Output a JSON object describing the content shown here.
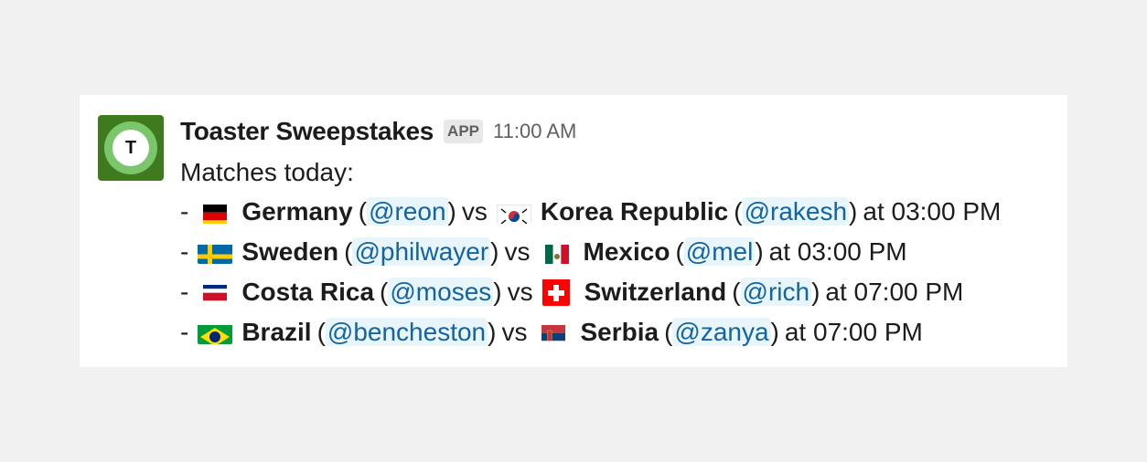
{
  "message": {
    "sender": "Toaster Sweepstakes",
    "badge": "APP",
    "time": "11:00 AM",
    "avatar_letter": "T",
    "intro": "Matches today:",
    "matches": [
      {
        "dash": "-",
        "home": {
          "name": "Germany",
          "mention": "@reon",
          "flag": "germany-flag-icon"
        },
        "vs": "vs",
        "away": {
          "name": "Korea Republic",
          "mention": "@rakesh",
          "flag": "south-korea-flag-icon"
        },
        "time_text": "at 03:00 PM"
      },
      {
        "dash": "-",
        "home": {
          "name": "Sweden",
          "mention": "@philwayer",
          "flag": "sweden-flag-icon"
        },
        "vs": "vs",
        "away": {
          "name": "Mexico",
          "mention": "@mel",
          "flag": "mexico-flag-icon"
        },
        "time_text": "at 03:00 PM"
      },
      {
        "dash": "-",
        "home": {
          "name": "Costa Rica",
          "mention": "@moses",
          "flag": "costa-rica-flag-icon"
        },
        "vs": "vs",
        "away": {
          "name": "Switzerland",
          "mention": "@rich",
          "flag": "switzerland-flag-icon"
        },
        "time_text": "at 07:00 PM"
      },
      {
        "dash": "-",
        "home": {
          "name": "Brazil",
          "mention": "@bencheston",
          "flag": "brazil-flag-icon"
        },
        "vs": "vs",
        "away": {
          "name": "Serbia",
          "mention": "@zanya",
          "flag": "serbia-flag-icon"
        },
        "time_text": "at 07:00 PM"
      }
    ]
  },
  "colors": {
    "mention_text": "#1264a3",
    "mention_bg": "#e8f5fa",
    "avatar_bg": "#3f7a1f"
  }
}
